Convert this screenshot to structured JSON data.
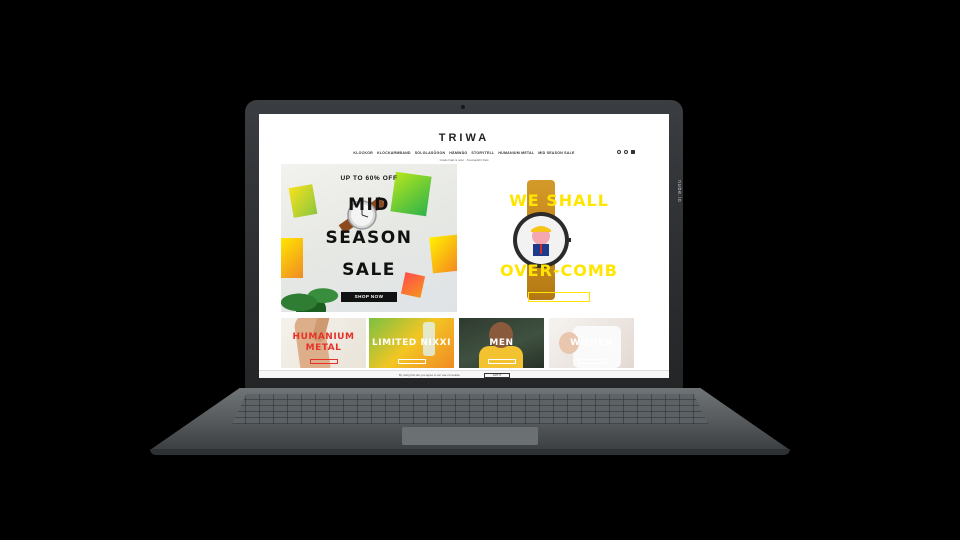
{
  "device": {
    "side_label": "nube.io"
  },
  "site": {
    "logo": "TRIWA",
    "nav": [
      "KLOCKOR",
      "KLOCKARMBAND",
      "SOLGLASÖGON",
      "HÄMWÅG",
      "STORYTELL",
      "HUMANIUM METAL",
      "MID SEASON SALE"
    ],
    "promo_strip": "Gratis frakt & retur · Kostnadsfri frakt"
  },
  "hero_left": {
    "supertitle": "UP TO 60% OFF",
    "line1": "MID",
    "line2": "SEASON",
    "line3": "SALE",
    "button": "SHOP NOW"
  },
  "hero_right": {
    "line1": "WE SHALL",
    "line2": "OVER-COMB"
  },
  "tiles": [
    {
      "label": "HUMANIUM METAL"
    },
    {
      "label": "LIMITED NIXXI"
    },
    {
      "label": "MEN"
    },
    {
      "label": "WOMEN"
    }
  ],
  "cookie_bar": {
    "text": "By using this site you agree to our use of cookies",
    "button": "GOT IT"
  },
  "colors": {
    "accent_yellow": "#ffe600",
    "accent_red": "#e63329"
  }
}
